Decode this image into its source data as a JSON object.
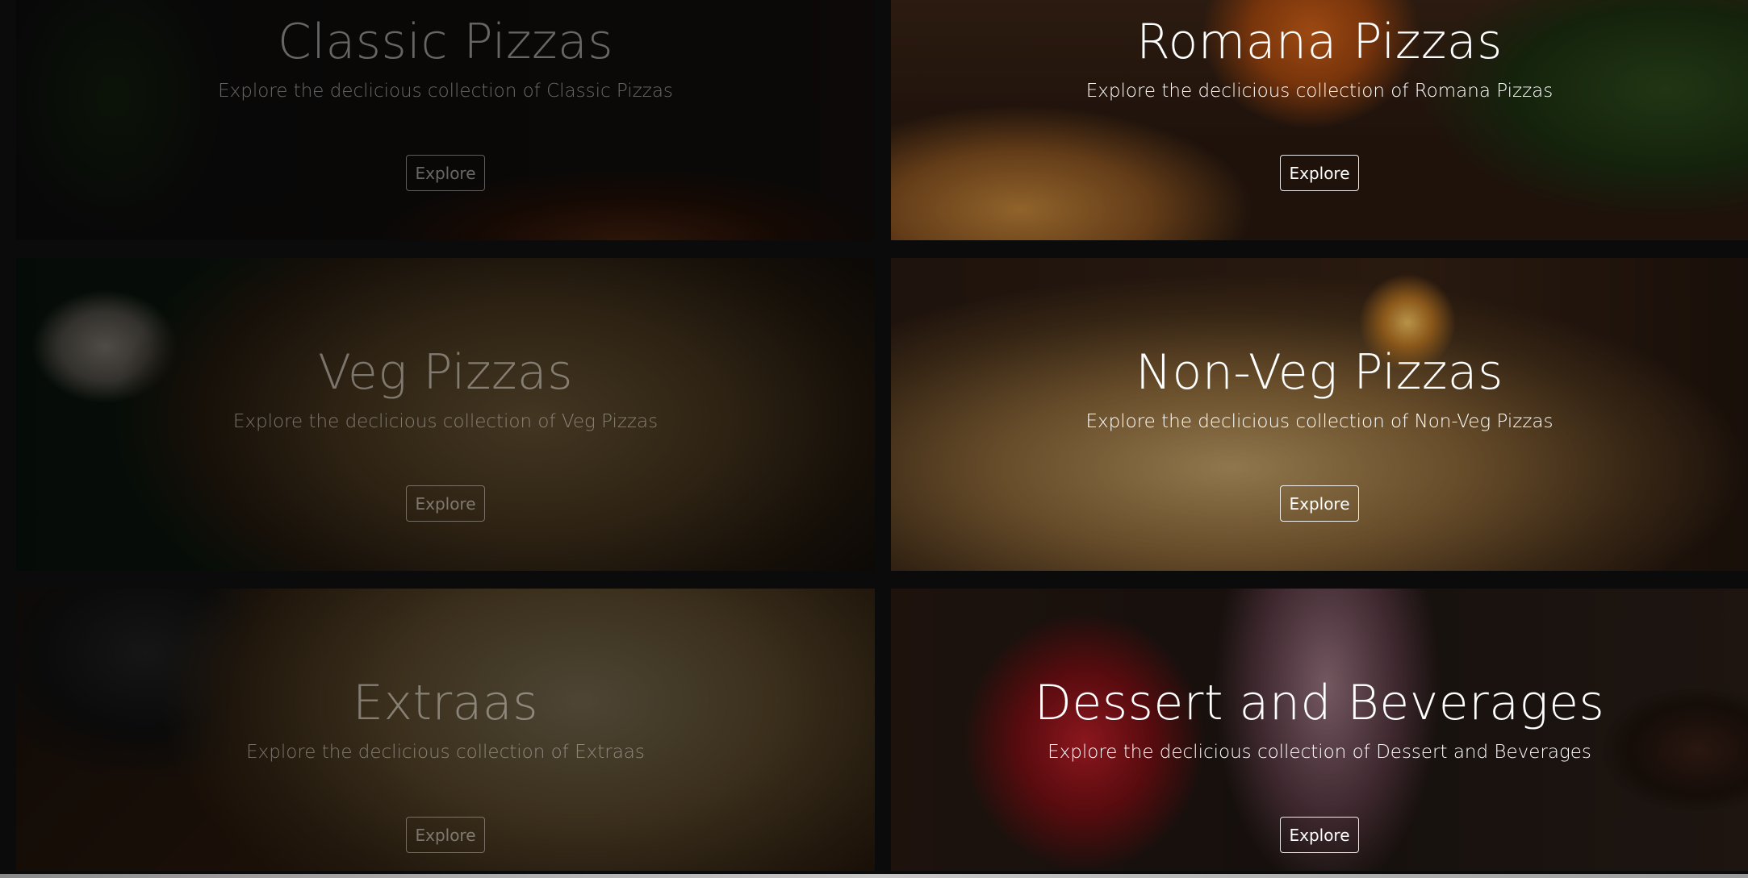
{
  "categories": [
    {
      "title": "Classic Pizzas",
      "description": "Explore the declicious collection of Classic Pizzas",
      "button_label": "Explore"
    },
    {
      "title": "Romana Pizzas",
      "description": "Explore the declicious collection of Romana Pizzas",
      "button_label": "Explore"
    },
    {
      "title": "Veg Pizzas",
      "description": "Explore the declicious collection of Veg Pizzas",
      "button_label": "Explore"
    },
    {
      "title": "Non-Veg Pizzas",
      "description": "Explore the declicious collection of Non-Veg Pizzas",
      "button_label": "Explore"
    },
    {
      "title": "Extraas",
      "description": "Explore the declicious collection of Extraas",
      "button_label": "Explore"
    },
    {
      "title": "Dessert and Beverages",
      "description": "Explore the declicious collection of Dessert and Beverages",
      "button_label": "Explore"
    }
  ]
}
